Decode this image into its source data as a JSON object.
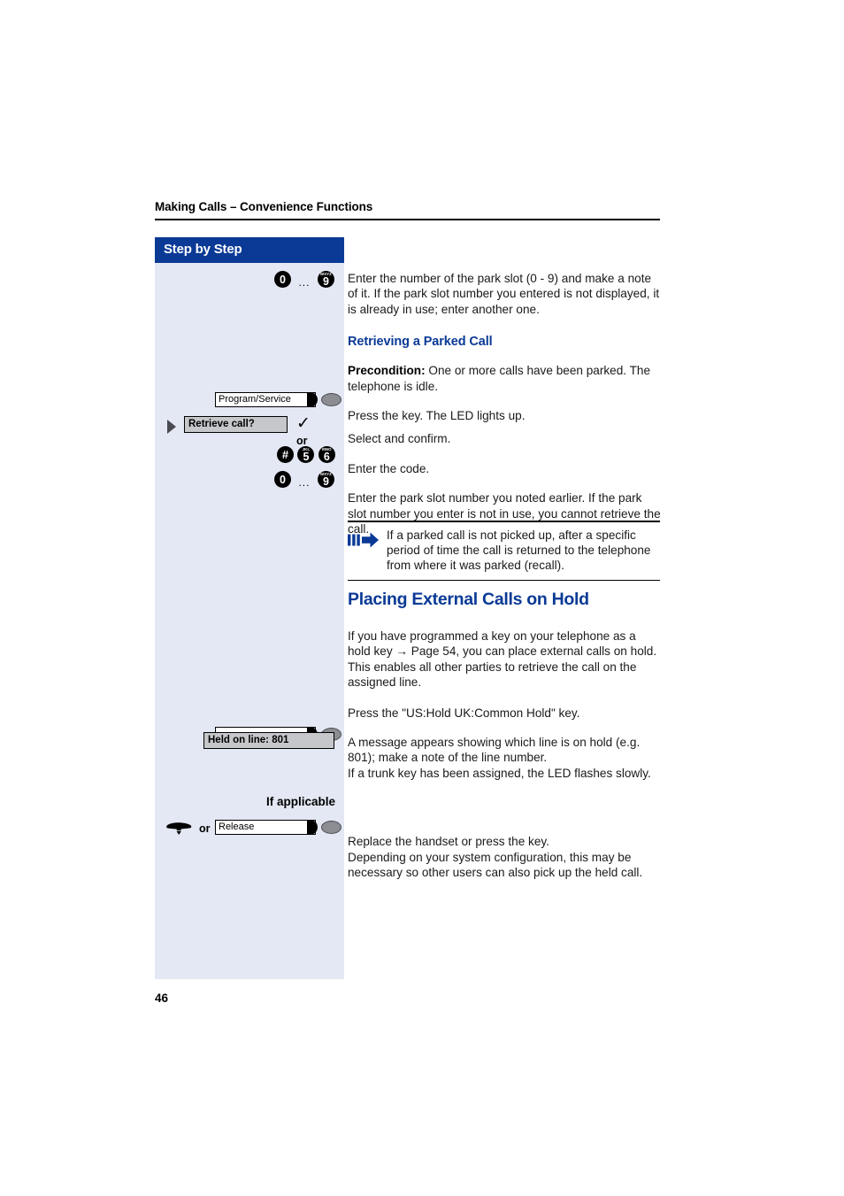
{
  "document": {
    "running_head": "Making Calls – Convenience Functions",
    "page_number": "46"
  },
  "sidebar": {
    "header_label": "Step by Step",
    "if_applicable_label": "If applicable",
    "or_label_1": "or",
    "or_label_2": "or",
    "keys": {
      "park_slot_from": "0",
      "park_slot_to": "9",
      "park_slot_to_letters": "WXYZ",
      "program_service_label": "Program/Service",
      "retrieve_call_label": "Retrieve call?",
      "code_hash": "#",
      "code_five": "5",
      "code_five_letters": "JKL",
      "code_six": "6",
      "code_six_letters": "MNO",
      "retrieve_slot_from": "0",
      "retrieve_slot_to": "9",
      "retrieve_slot_to_letters": "WXYZ",
      "hold_key_label": "",
      "held_on_line_label": "Held on line: 801",
      "release_label": "Release"
    }
  },
  "body": {
    "p_enter_park_slot": "Enter the number of the park slot (0 - 9) and make a note of it. If the park slot number you entered is not displayed, it is already in use; enter another one.",
    "h_retrieving_parked_call": "Retrieving a Parked Call",
    "precondition_label": "Precondition:",
    "precondition_text": " One or more calls have been parked. The telephone is idle.",
    "p_press_key_led": "Press the key. The LED lights up.",
    "p_select_confirm": "Select and confirm.",
    "p_enter_code": "Enter the code.",
    "p_enter_park_slot_noted": "Enter the park slot number you noted earlier. If the park slot number you enter is not in use, you cannot retrieve the call.",
    "note_text": "If a parked call is not picked up, after a specific period of time the call is returned to the telephone from where it was parked (recall).",
    "h_placing_external_calls": "Placing External Calls on Hold",
    "p_hold_key_intro": "If you have programmed a key on your telephone as a hold key → Page 54, you can place external calls on hold.",
    "p_hold_key_intro2": "This enables all other parties to retrieve the call on the assigned line.",
    "p_press_hold_key": "Press the \"US:Hold UK:Common Hold\" key.",
    "p_message_line": "A message appears showing which line is on hold (e.g. 801); make a note of the line number.",
    "p_trunk_key": "If a trunk key has been assigned, the LED flashes slowly.",
    "p_replace_handset": "Replace the handset or press the key.",
    "p_replace_handset2": "Depending on your system configuration, this may be necessary so other users can also pick up the held call."
  },
  "colors": {
    "accent_blue": "#0a3a96",
    "sidebar_bg": "#e4e8f4",
    "display_gray": "#c6c7cb",
    "led_gray": "#8b8d92"
  }
}
